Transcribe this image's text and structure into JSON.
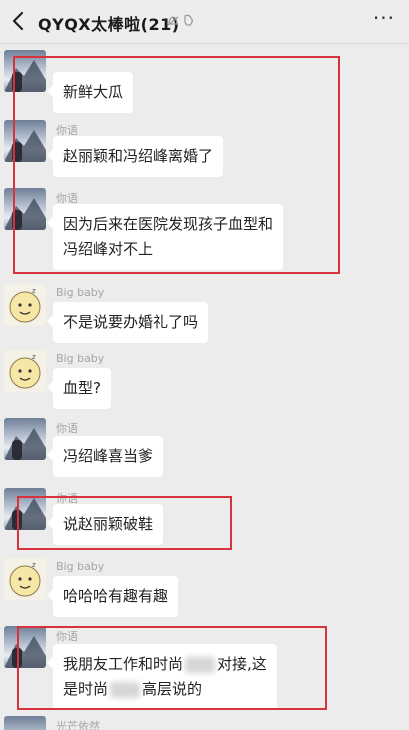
{
  "header": {
    "title": "QYQX太棒啦(21)",
    "more": "···"
  },
  "messages": [
    {
      "sender": "",
      "text": "新鲜大瓜"
    },
    {
      "sender": "你语",
      "text": "赵丽颖和冯绍峰离婚了"
    },
    {
      "sender": "你语",
      "line1": "因为后来在医院发现孩子血型和",
      "line2": "冯绍峰对不上"
    },
    {
      "sender": "Big baby",
      "text": "不是说要办婚礼了吗"
    },
    {
      "sender": "Big baby",
      "text": "血型?"
    },
    {
      "sender": "你语",
      "text": "冯绍峰喜当爹"
    },
    {
      "sender": "你语",
      "text": "说赵丽颖破鞋"
    },
    {
      "sender": "Big baby",
      "text": "哈哈哈有趣有趣"
    },
    {
      "sender": "你语",
      "line1a": "我朋友工作和时尚",
      "line1b": "对接,这",
      "line2a": "是时尚",
      "line2b": "高层说的"
    },
    {
      "sender": "光芒依然"
    }
  ],
  "colors": {
    "highlight_box": "#d8323c",
    "bubble": "#ffffff",
    "background": "#ececec"
  }
}
